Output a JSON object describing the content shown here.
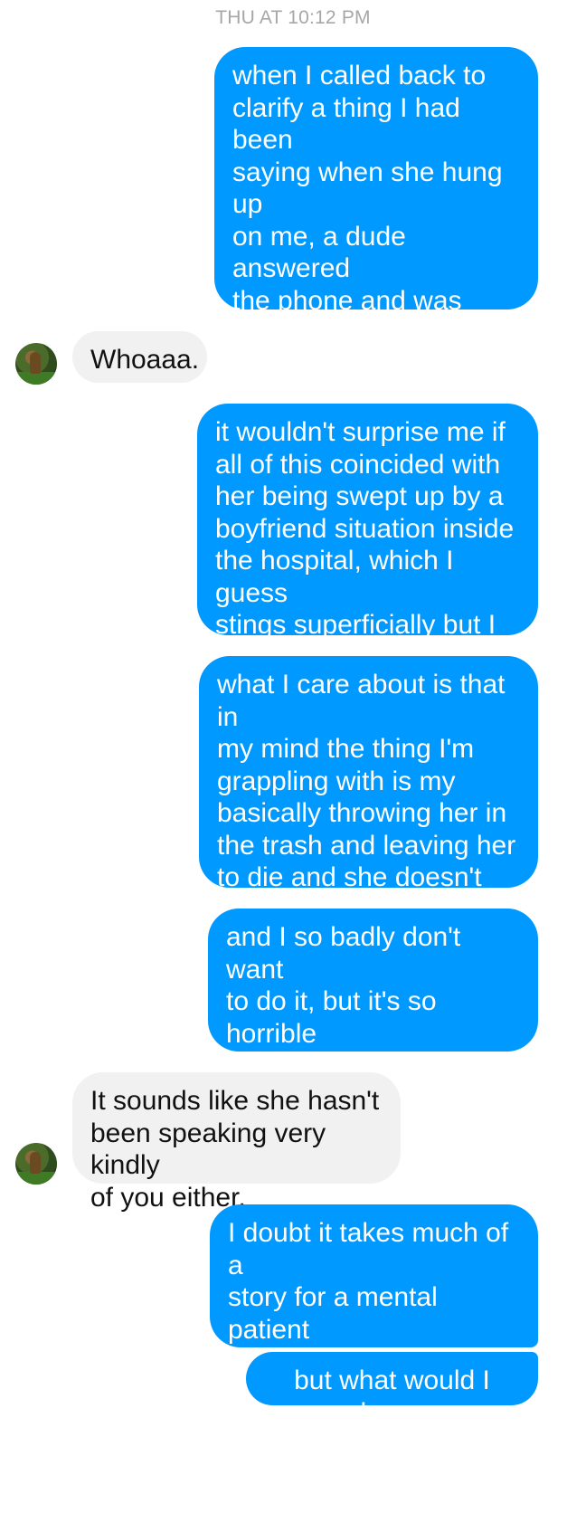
{
  "header": {
    "timestamp": "THU AT 10:12 PM"
  },
  "messages": [
    {
      "sender": "me",
      "text": "when I called back to\nclarify a thing I had been\nsaying when she hung up\non me, a dude answered\nthe phone and was very\nsatisfied to laugh at me\nsaying the phones were\nclosed and I fucked up"
    },
    {
      "sender": "them",
      "text": "Whoaaa."
    },
    {
      "sender": "me",
      "text": "it wouldn't surprise me if\nall of this coincided with\nher being swept up by a\nboyfriend situation inside\nthe hospital, which I guess\nstings superficially but I\ndon't particularly even care"
    },
    {
      "sender": "me",
      "text": "what I care about is that in\nmy mind the thing I'm\ngrappling with is my\nbasically throwing her in\nthe trash and leaving her\nto die and she doesn't\neven fucking know"
    },
    {
      "sender": "me",
      "text": "and I so badly don't want\nto do it, but it's so horrible\nthat I think I just have to\ndo it, and that I did do it"
    },
    {
      "sender": "them",
      "text": "It sounds like she hasn't\nbeen speaking very kindly\nof you either."
    },
    {
      "sender": "me",
      "text": "I doubt it takes much of a\nstory for a mental patient\nto wave his dick around\nfor a girl"
    },
    {
      "sender": "me",
      "text": "but what would I know"
    }
  ],
  "colors": {
    "outgoing_bubble": "#0099ff",
    "incoming_bubble": "#f1f1f1",
    "timestamp": "#a7a7a7"
  },
  "icons": {
    "contact_avatar": "avatar-icon"
  }
}
